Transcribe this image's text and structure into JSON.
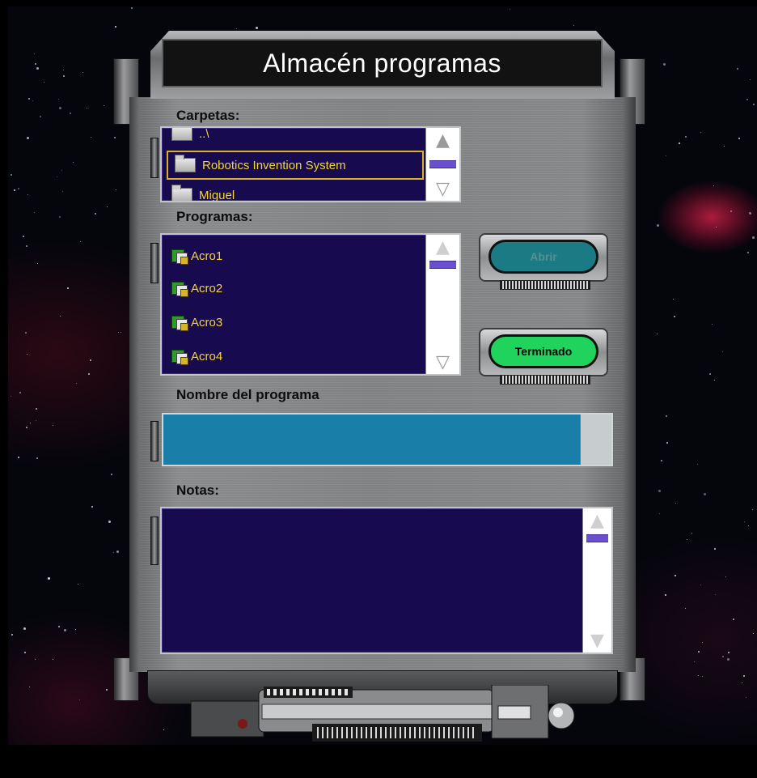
{
  "window": {
    "title": "Almacén programas"
  },
  "folders": {
    "label": "Carpetas:",
    "items": [
      {
        "label": "..\\"
      },
      {
        "label": "Robotics Invention System",
        "selected": true
      },
      {
        "label": "Miguel"
      }
    ]
  },
  "programs": {
    "label": "Programas:",
    "items": [
      {
        "label": "Acro1"
      },
      {
        "label": "Acro2"
      },
      {
        "label": "Acro3"
      },
      {
        "label": "Acro4"
      }
    ]
  },
  "buttons": {
    "open": {
      "label": "Abrir",
      "enabled": false,
      "color": "#1a7b84"
    },
    "done": {
      "label": "Terminado",
      "enabled": true,
      "color": "#1fd35c"
    }
  },
  "program_name": {
    "label": "Nombre del programa",
    "value": ""
  },
  "notes": {
    "label": "Notas:",
    "value": ""
  },
  "colors": {
    "list_bg": "#180a4e",
    "list_text": "#f4d630",
    "input_bg": "#197fa8",
    "scroll_thumb": "#6a4fd0"
  },
  "icons": {
    "folder": "folder-icon",
    "program": "program-lock-icon",
    "scroll_up": "arrow-up-icon",
    "scroll_down": "arrow-down-icon"
  }
}
